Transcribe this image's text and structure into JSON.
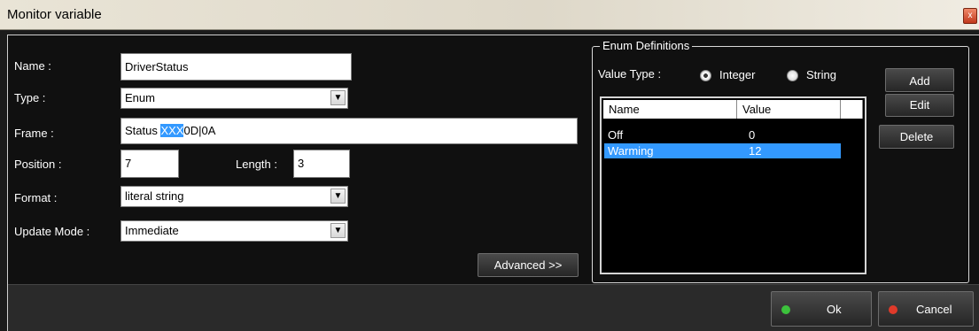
{
  "window": {
    "title": "Monitor variable",
    "close_glyph": "x"
  },
  "form": {
    "name_label": "Name :",
    "name_value": "DriverStatus",
    "type_label": "Type :",
    "type_value": "Enum",
    "frame_label": "Frame :",
    "frame_prefix": "Status ",
    "frame_selected": "XXX",
    "frame_suffix": "0D|0A",
    "position_label": "Position :",
    "position_value": "7",
    "length_label": "Length :",
    "length_value": "3",
    "format_label": "Format :",
    "format_value": "literal string",
    "update_label": "Update Mode :",
    "update_value": "Immediate",
    "advanced_label": "Advanced >>"
  },
  "enum_panel": {
    "legend": "Enum Definitions",
    "value_type_label": "Value Type :",
    "radio_integer": "Integer",
    "radio_string": "String",
    "selected_type": "Integer",
    "columns": [
      "Name",
      "Value"
    ],
    "rows": [
      {
        "name": "Off",
        "value": "0",
        "selected": false
      },
      {
        "name": "Warming",
        "value": "12",
        "selected": true
      }
    ],
    "add_label": "Add",
    "edit_label": "Edit",
    "delete_label": "Delete"
  },
  "footer": {
    "ok_label": "Ok",
    "cancel_label": "Cancel",
    "ok_dot_color": "#3cc23c",
    "cancel_dot_color": "#e03a2a"
  }
}
